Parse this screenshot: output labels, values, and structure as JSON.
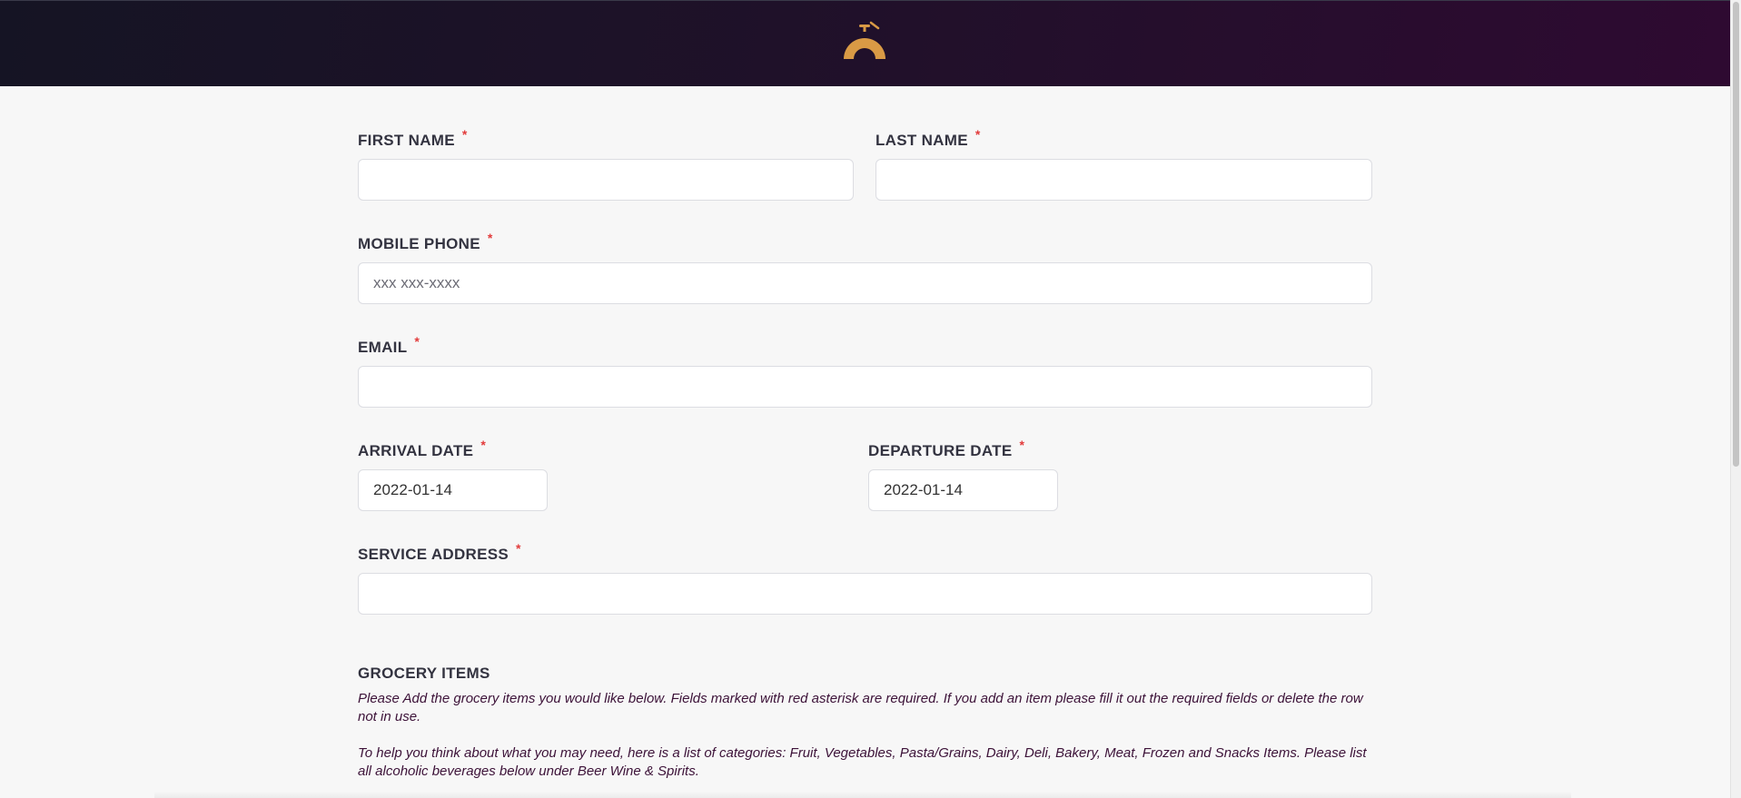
{
  "header": {
    "logo_icon": "horseshoe-bell-logo",
    "logo_color": "#d99a45",
    "background_colors": [
      "#151424",
      "#2e0a31"
    ]
  },
  "form": {
    "first_name": {
      "label": "FIRST NAME",
      "required": "*",
      "value": ""
    },
    "last_name": {
      "label": "LAST NAME",
      "required": "*",
      "value": ""
    },
    "mobile_phone": {
      "label": "MOBILE PHONE",
      "required": "*",
      "value": "",
      "placeholder": "xxx xxx-xxxx"
    },
    "email": {
      "label": "EMAIL",
      "required": "*",
      "value": ""
    },
    "arrival_date": {
      "label": "ARRIVAL DATE",
      "required": "*",
      "value": "2022-01-14"
    },
    "departure_date": {
      "label": "DEPARTURE DATE",
      "required": "*",
      "value": "2022-01-14"
    },
    "service_address": {
      "label": "SERVICE ADDRESS",
      "required": "*",
      "value": ""
    }
  },
  "grocery": {
    "title": "GROCERY ITEMS",
    "instructions": "Please Add the grocery items you would like below. Fields marked with red asterisk are required. If you add an item please fill it out the required fields or delete the row not in use.",
    "categories_note": "To help you think about what you may need, here is a list of categories: Fruit, Vegetables, Pasta/Grains, Dairy, Deli, Bakery, Meat, Frozen and Snacks Items. Please list all alcoholic beverages below under Beer Wine & Spirits."
  },
  "colors": {
    "required_asterisk": "#e23b3b",
    "help_text": "#3c1238"
  }
}
